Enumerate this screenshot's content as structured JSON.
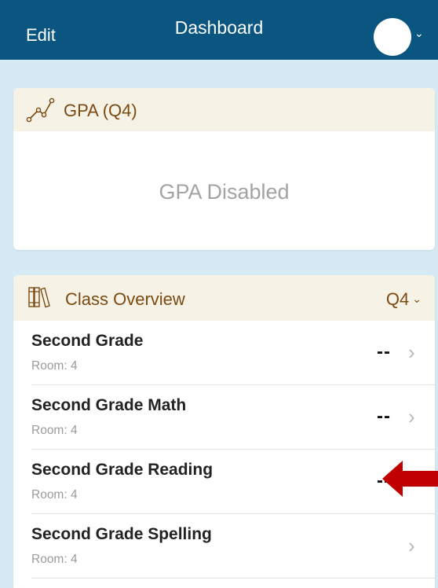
{
  "navbar": {
    "edit": "Edit",
    "title": "Dashboard",
    "avatar_chevron": "⌄"
  },
  "gpa": {
    "title": "GPA (Q4)",
    "status": "GPA Disabled",
    "icon": "line-chart-icon"
  },
  "classes": {
    "title": "Class Overview",
    "quarter": "Q4",
    "quarter_chevron": "⌄",
    "icon": "books-icon",
    "rows": [
      {
        "name": "Second Grade",
        "room": "Room: 4",
        "grade": "--"
      },
      {
        "name": "Second Grade Math",
        "room": "Room: 4",
        "grade": "--"
      },
      {
        "name": "Second Grade Reading",
        "room": "Room: 4",
        "grade": "--"
      },
      {
        "name": "Second Grade Spelling",
        "room": "Room: 4",
        "grade": ""
      }
    ]
  },
  "colors": {
    "navbar": "#0a5680",
    "background": "#d6eaf5",
    "card_header": "#f7f2e6",
    "header_text": "#7b4a12",
    "annotation_arrow": "#c00000"
  }
}
